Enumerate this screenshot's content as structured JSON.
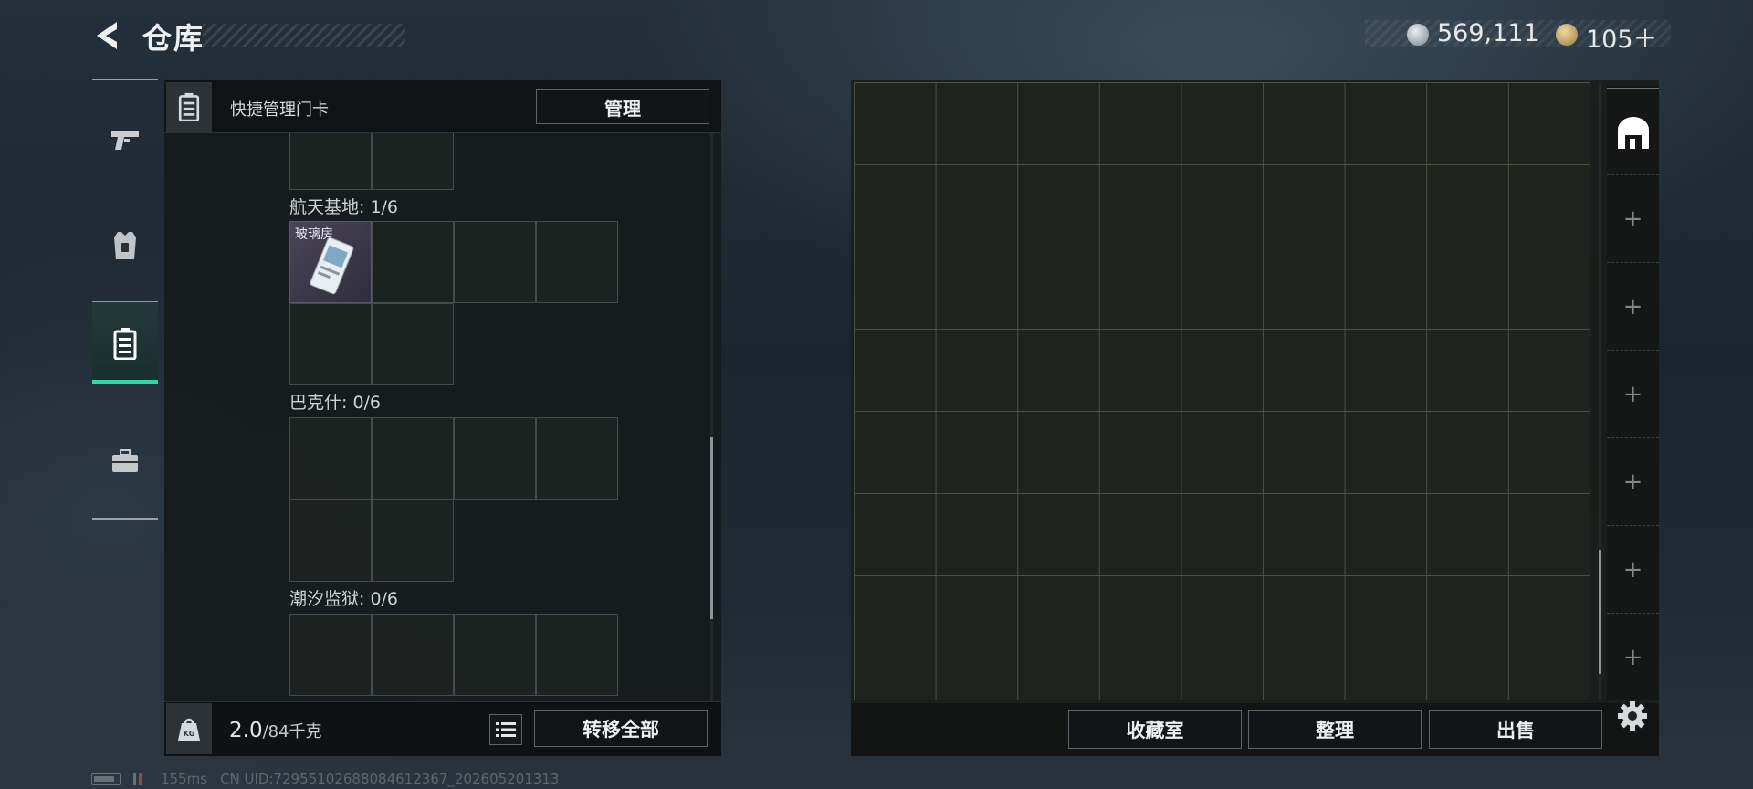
{
  "header": {
    "title": "仓库",
    "currencies": [
      {
        "icon": "silver-coin-icon",
        "value": "569,111"
      },
      {
        "icon": "gold-coin-icon",
        "value": "105＋"
      }
    ]
  },
  "nav_rail": [
    {
      "icon": "pistol-icon",
      "active": false
    },
    {
      "icon": "armor-vest-icon",
      "active": false
    },
    {
      "icon": "keycard-holder-icon",
      "active": true
    },
    {
      "icon": "toolbox-icon",
      "active": false
    }
  ],
  "keycard_panel": {
    "title": "快捷管理门卡",
    "manage_label": "管理",
    "sections": [
      {
        "name": "航天基地: 1/6",
        "items": [
          {
            "name": "玻璃房",
            "icon": "keycard-icon"
          }
        ]
      },
      {
        "name": "巴克什: 0/6",
        "items": []
      },
      {
        "name": "潮汐监狱: 0/6",
        "items": []
      }
    ],
    "weight": {
      "current": "2.0",
      "capacity": "/84千克"
    },
    "transfer_all_label": "转移全部"
  },
  "stash": {
    "tabs": [
      {
        "icon": "stash-door-icon",
        "active": true
      },
      {
        "icon": "plus-icon",
        "label": "+",
        "active": false
      },
      {
        "icon": "plus-icon",
        "label": "+",
        "active": false
      },
      {
        "icon": "plus-icon",
        "label": "+",
        "active": false
      },
      {
        "icon": "plus-icon",
        "label": "+",
        "active": false
      },
      {
        "icon": "plus-icon",
        "label": "+",
        "active": false
      },
      {
        "icon": "plus-icon",
        "label": "+",
        "active": false
      }
    ],
    "buttons": {
      "collection": "收藏室",
      "sort": "整理",
      "sell": "出售"
    }
  },
  "status_bar": {
    "ping": "155ms",
    "uid": "CN UID:7295510268808461236​7_202605201313"
  },
  "colors": {
    "accent": "#2fd7a3",
    "panel_bg": "#161a1c",
    "grid_line": "#4a5147"
  }
}
